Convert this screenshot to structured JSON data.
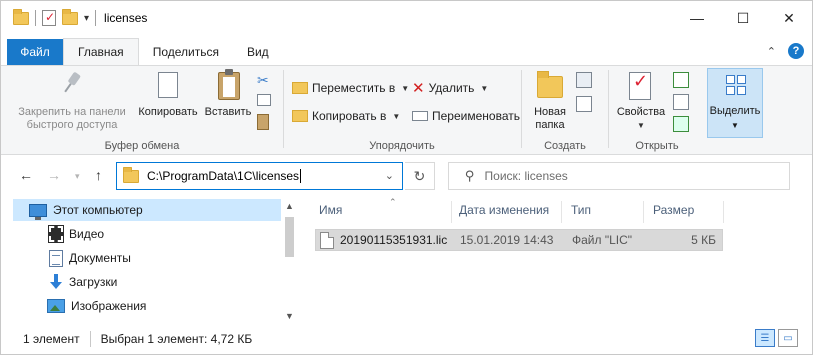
{
  "window": {
    "title": "licenses",
    "controls": {
      "minimize": "—",
      "maximize": "☐",
      "close": "✕"
    }
  },
  "quick_access": {
    "dropdown": "▾"
  },
  "ribbon_tabs": [
    {
      "label": "Файл"
    },
    {
      "label": "Главная"
    },
    {
      "label": "Поделиться"
    },
    {
      "label": "Вид"
    }
  ],
  "ribbon": {
    "clipboard": {
      "label": "Буфер обмена",
      "pin": "Закрепить на панели быстрого доступа",
      "pin_line1": "Закрепить на панели",
      "pin_line2": "быстрого доступа",
      "copy": "Копировать",
      "paste": "Вставить"
    },
    "organize": {
      "label": "Упорядочить",
      "move_to": "Переместить в",
      "copy_to": "Копировать в",
      "delete": "Удалить",
      "rename": "Переименовать"
    },
    "create": {
      "label": "Создать",
      "new_folder_line1": "Новая",
      "new_folder_line2": "папка"
    },
    "open": {
      "label": "Открыть",
      "properties": "Свойства"
    },
    "select": {
      "label": "Выделить"
    }
  },
  "address": {
    "path": "C:\\ProgramData\\1C\\licenses",
    "search_placeholder": "Поиск: licenses"
  },
  "nav_pane": {
    "items": [
      {
        "label": "Этот компьютер",
        "icon": "monitor-icon"
      },
      {
        "label": "Видео",
        "icon": "video-icon"
      },
      {
        "label": "Документы",
        "icon": "documents-icon"
      },
      {
        "label": "Загрузки",
        "icon": "downloads-icon"
      },
      {
        "label": "Изображения",
        "icon": "pictures-icon"
      }
    ]
  },
  "file_list": {
    "columns": [
      "Имя",
      "Дата изменения",
      "Тип",
      "Размер"
    ],
    "rows": [
      {
        "name": "20190115351931.lic",
        "modified": "15.01.2019 14:43",
        "type": "Файл \"LIC\"",
        "size": "5 КБ"
      }
    ]
  },
  "status": {
    "count": "1 элемент",
    "selected": "Выбран 1 элемент: 4,72 КБ"
  },
  "colors": {
    "accent": "#1979ca",
    "selection": "#cce8ff",
    "address_border": "#0078d7"
  }
}
